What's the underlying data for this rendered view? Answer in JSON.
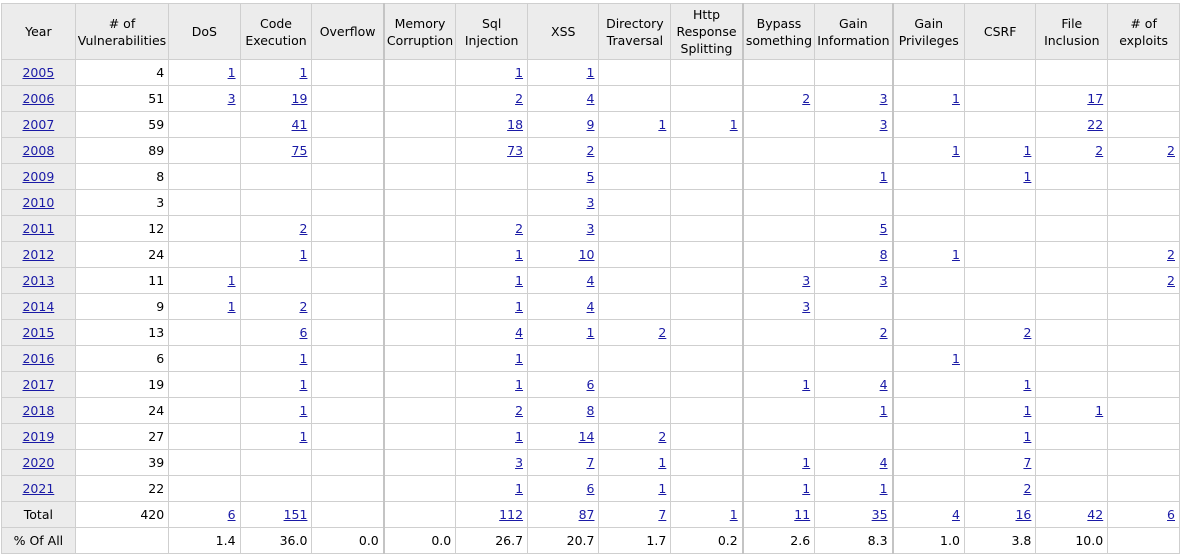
{
  "headers": [
    "Year",
    "# of Vulnerabilities",
    "DoS",
    "Code Execution",
    "Overflow",
    "Memory Corruption",
    "Sql Injection",
    "XSS",
    "Directory Traversal",
    "Http Response Splitting",
    "Bypass something",
    "Gain Information",
    "Gain Privileges",
    "CSRF",
    "File Inclusion",
    "# of exploits"
  ],
  "rows": [
    {
      "year": "2005",
      "vulns": "4",
      "cells": [
        "1",
        "1",
        "",
        "",
        "1",
        "1",
        "",
        "",
        "",
        "",
        "",
        "",
        "",
        ""
      ]
    },
    {
      "year": "2006",
      "vulns": "51",
      "cells": [
        "3",
        "19",
        "",
        "",
        "2",
        "4",
        "",
        "",
        "2",
        "3",
        "1",
        "",
        "17",
        ""
      ]
    },
    {
      "year": "2007",
      "vulns": "59",
      "cells": [
        "",
        "41",
        "",
        "",
        "18",
        "9",
        "1",
        "1",
        "",
        "3",
        "",
        "",
        "22",
        ""
      ]
    },
    {
      "year": "2008",
      "vulns": "89",
      "cells": [
        "",
        "75",
        "",
        "",
        "73",
        "2",
        "",
        "",
        "",
        "",
        "1",
        "1",
        "2",
        "2"
      ]
    },
    {
      "year": "2009",
      "vulns": "8",
      "cells": [
        "",
        "",
        "",
        "",
        "",
        "5",
        "",
        "",
        "",
        "1",
        "",
        "1",
        "",
        ""
      ]
    },
    {
      "year": "2010",
      "vulns": "3",
      "cells": [
        "",
        "",
        "",
        "",
        "",
        "3",
        "",
        "",
        "",
        "",
        "",
        "",
        "",
        ""
      ]
    },
    {
      "year": "2011",
      "vulns": "12",
      "cells": [
        "",
        "2",
        "",
        "",
        "2",
        "3",
        "",
        "",
        "",
        "5",
        "",
        "",
        "",
        ""
      ]
    },
    {
      "year": "2012",
      "vulns": "24",
      "cells": [
        "",
        "1",
        "",
        "",
        "1",
        "10",
        "",
        "",
        "",
        "8",
        "1",
        "",
        "",
        "2"
      ]
    },
    {
      "year": "2013",
      "vulns": "11",
      "cells": [
        "1",
        "",
        "",
        "",
        "1",
        "4",
        "",
        "",
        "3",
        "3",
        "",
        "",
        "",
        "2"
      ]
    },
    {
      "year": "2014",
      "vulns": "9",
      "cells": [
        "1",
        "2",
        "",
        "",
        "1",
        "4",
        "",
        "",
        "3",
        "",
        "",
        "",
        "",
        ""
      ]
    },
    {
      "year": "2015",
      "vulns": "13",
      "cells": [
        "",
        "6",
        "",
        "",
        "4",
        "1",
        "2",
        "",
        "",
        "2",
        "",
        "2",
        "",
        ""
      ]
    },
    {
      "year": "2016",
      "vulns": "6",
      "cells": [
        "",
        "1",
        "",
        "",
        "1",
        "",
        "",
        "",
        "",
        "",
        "1",
        "",
        "",
        ""
      ]
    },
    {
      "year": "2017",
      "vulns": "19",
      "cells": [
        "",
        "1",
        "",
        "",
        "1",
        "6",
        "",
        "",
        "1",
        "4",
        "",
        "1",
        "",
        ""
      ]
    },
    {
      "year": "2018",
      "vulns": "24",
      "cells": [
        "",
        "1",
        "",
        "",
        "2",
        "8",
        "",
        "",
        "",
        "1",
        "",
        "1",
        "1",
        ""
      ]
    },
    {
      "year": "2019",
      "vulns": "27",
      "cells": [
        "",
        "1",
        "",
        "",
        "1",
        "14",
        "2",
        "",
        "",
        "",
        "",
        "1",
        "",
        ""
      ]
    },
    {
      "year": "2020",
      "vulns": "39",
      "cells": [
        "",
        "",
        "",
        "",
        "3",
        "7",
        "1",
        "",
        "1",
        "4",
        "",
        "7",
        "",
        ""
      ]
    },
    {
      "year": "2021",
      "vulns": "22",
      "cells": [
        "",
        "",
        "",
        "",
        "1",
        "6",
        "1",
        "",
        "1",
        "1",
        "",
        "2",
        "",
        ""
      ]
    }
  ],
  "total": {
    "label": "Total",
    "vulns": "420",
    "cells": [
      "6",
      "151",
      "",
      "",
      "112",
      "87",
      "7",
      "1",
      "11",
      "35",
      "4",
      "16",
      "42",
      "6"
    ]
  },
  "percent": {
    "label": "% Of All",
    "vulns": "",
    "cells": [
      "1.4",
      "36.0",
      "0.0",
      "0.0",
      "26.7",
      "20.7",
      "1.7",
      "0.2",
      "2.6",
      "8.3",
      "1.0",
      "3.8",
      "10.0",
      ""
    ]
  }
}
